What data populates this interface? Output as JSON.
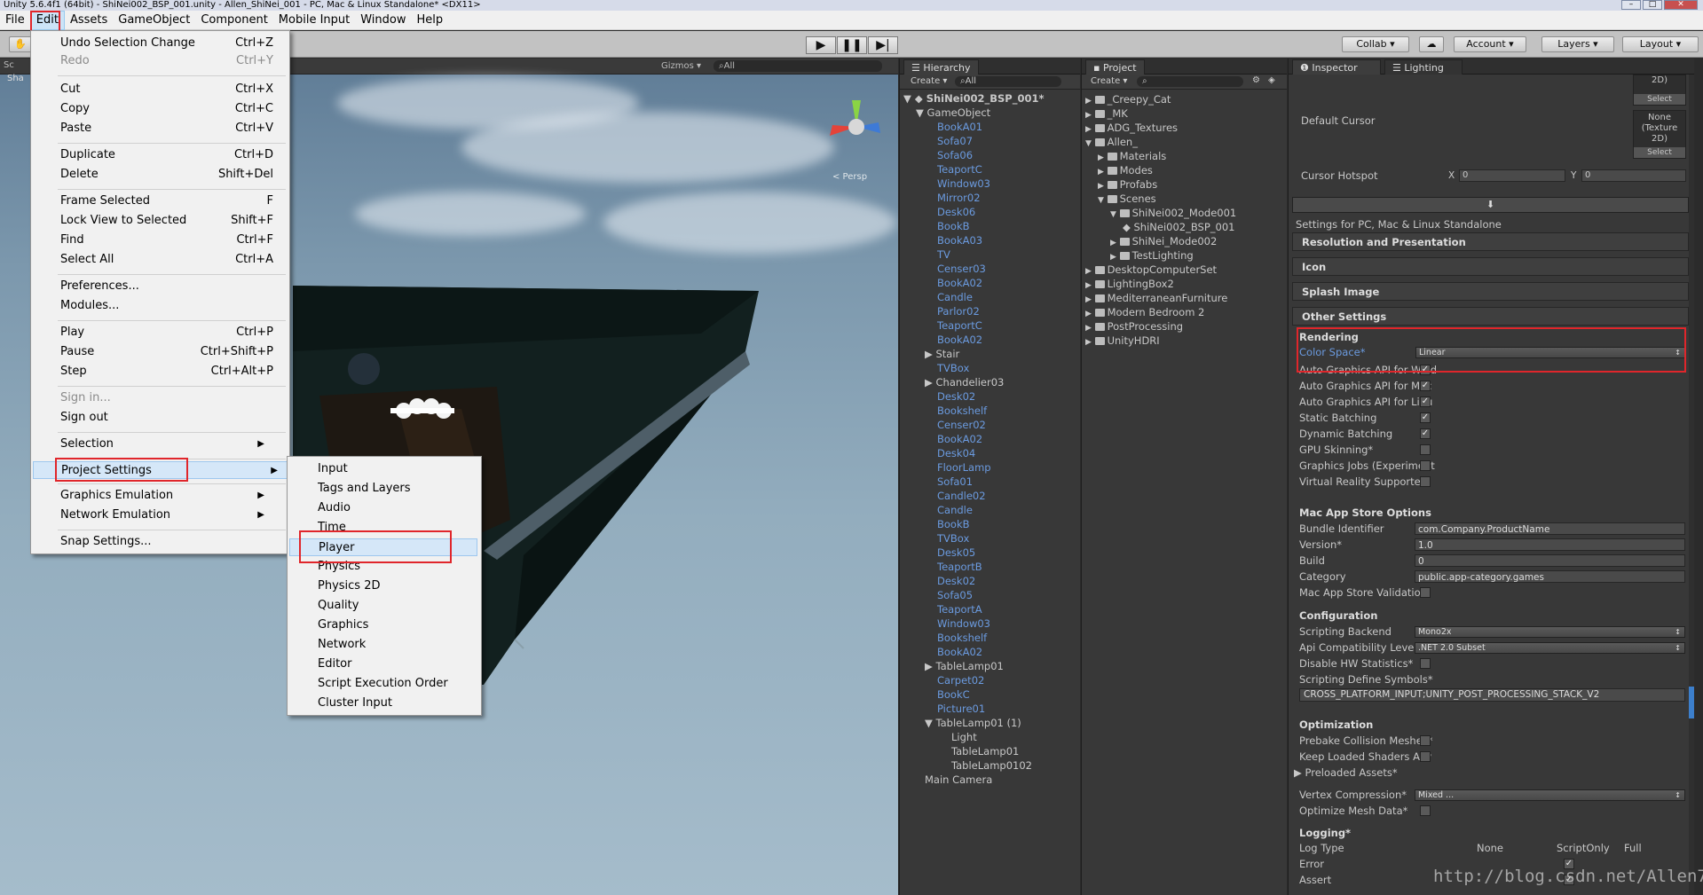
{
  "window": {
    "title": "Unity 5.6.4f1 (64bit) - ShiNei002_BSP_001.unity - Allen_ShiNei_001 - PC, Mac & Linux Standalone* <DX11>"
  },
  "menubar": [
    "File",
    "Edit",
    "Assets",
    "GameObject",
    "Component",
    "Mobile Input",
    "Window",
    "Help"
  ],
  "toolbar": {
    "collab": "Collab ▾",
    "account": "Account",
    "layers": "Layers",
    "layout": "Layout"
  },
  "scene": {
    "gizmos": "Gizmos ▾",
    "search": "All",
    "persp": "< Persp",
    "tab1": "Sc",
    "tab2": "Sha"
  },
  "edit_menu": [
    {
      "label": "Undo Selection Change",
      "shortcut": "Ctrl+Z",
      "disabled": false
    },
    {
      "label": "Redo",
      "shortcut": "Ctrl+Y",
      "disabled": true
    },
    {
      "label": "Cut",
      "shortcut": "Ctrl+X"
    },
    {
      "label": "Copy",
      "shortcut": "Ctrl+C"
    },
    {
      "label": "Paste",
      "shortcut": "Ctrl+V"
    },
    {
      "label": "Duplicate",
      "shortcut": "Ctrl+D"
    },
    {
      "label": "Delete",
      "shortcut": "Shift+Del"
    },
    {
      "label": "Frame Selected",
      "shortcut": "F"
    },
    {
      "label": "Lock View to Selected",
      "shortcut": "Shift+F"
    },
    {
      "label": "Find",
      "shortcut": "Ctrl+F"
    },
    {
      "label": "Select All",
      "shortcut": "Ctrl+A"
    },
    {
      "label": "Preferences...",
      "shortcut": ""
    },
    {
      "label": "Modules...",
      "shortcut": ""
    },
    {
      "label": "Play",
      "shortcut": "Ctrl+P"
    },
    {
      "label": "Pause",
      "shortcut": "Ctrl+Shift+P"
    },
    {
      "label": "Step",
      "shortcut": "Ctrl+Alt+P"
    },
    {
      "label": "Sign in...",
      "shortcut": "",
      "disabled": true
    },
    {
      "label": "Sign out",
      "shortcut": ""
    },
    {
      "label": "Selection",
      "shortcut": ""
    },
    {
      "label": "Project Settings",
      "shortcut": ""
    },
    {
      "label": "Graphics Emulation",
      "shortcut": ""
    },
    {
      "label": "Network Emulation",
      "shortcut": ""
    },
    {
      "label": "Snap Settings...",
      "shortcut": ""
    }
  ],
  "project_settings_submenu": [
    "Input",
    "Tags and Layers",
    "Audio",
    "Time",
    "Player",
    "Physics",
    "Physics 2D",
    "Quality",
    "Graphics",
    "Network",
    "Editor",
    "Script Execution Order",
    "Cluster Input"
  ],
  "hierarchy": {
    "tab": "Hierarchy",
    "create": "Create ▾",
    "search": "All",
    "scene": "ShiNei002_BSP_001*",
    "root": "GameObject",
    "items": [
      "BookA01",
      "Sofa07",
      "Sofa06",
      "TeaportC",
      "Window03",
      "Mirror02",
      "Desk06",
      "BookB",
      "BookA03",
      "TV",
      "Censer03",
      "BookA02",
      "Candle",
      "Parlor02",
      "TeaportC",
      "BookA02",
      "Stair",
      "TVBox",
      "Chandelier03",
      "Desk02",
      "Bookshelf",
      "Censer02",
      "BookA02",
      "Desk04",
      "FloorLamp",
      "Sofa01",
      "Candle02",
      "Candle",
      "BookB",
      "TVBox",
      "Desk05",
      "TeaportB",
      "Desk02",
      "Sofa05",
      "TeaportA",
      "Window03",
      "Bookshelf",
      "BookA02",
      "TableLamp01",
      "Carpet02",
      "BookC",
      "Picture01",
      "TableLamp01 (1)"
    ],
    "lamp_children": [
      "Light",
      "TableLamp01",
      "TableLamp0102"
    ],
    "main_camera": "Main Camera"
  },
  "project": {
    "tab": "Project",
    "create": "Create ▾",
    "tree": [
      {
        "label": "_Creepy_Cat",
        "depth": 0
      },
      {
        "label": "_MK",
        "depth": 0
      },
      {
        "label": "ADG_Textures",
        "depth": 0
      },
      {
        "label": "Allen_",
        "depth": 0
      },
      {
        "label": "Materials",
        "depth": 1
      },
      {
        "label": "Modes",
        "depth": 1
      },
      {
        "label": "Profabs",
        "depth": 1
      },
      {
        "label": "Scenes",
        "depth": 1
      },
      {
        "label": "ShiNei002_Mode001",
        "depth": 2
      },
      {
        "label": "ShiNei002_BSP_001",
        "depth": 3
      },
      {
        "label": "ShiNei_Mode002",
        "depth": 2
      },
      {
        "label": "TestLighting",
        "depth": 2
      },
      {
        "label": "DesktopComputerSet",
        "depth": 0
      },
      {
        "label": "LightingBox2",
        "depth": 0
      },
      {
        "label": "MediterraneanFurniture",
        "depth": 0
      },
      {
        "label": "Modern Bedroom 2",
        "depth": 0
      },
      {
        "label": "PostProcessing",
        "depth": 0
      },
      {
        "label": "UnityHDRI",
        "depth": 0
      }
    ]
  },
  "inspector": {
    "tab": "Inspector",
    "tab2": "Lighting",
    "tex_top": "2D)",
    "select": "Select",
    "default_cursor": "Default Cursor",
    "none_tex": "None (Texture 2D)",
    "cursor_hotspot": "Cursor Hotspot",
    "hotspot_x_label": "X",
    "hotspot_x": "0",
    "hotspot_y_label": "Y",
    "hotspot_y": "0",
    "platform_label": "Settings for PC, Mac & Linux Standalone",
    "sections": [
      "Resolution and Presentation",
      "Icon",
      "Splash Image",
      "Other Settings"
    ],
    "rendering": "Rendering",
    "color_space_label": "Color Space*",
    "color_space": "Linear",
    "checks": [
      {
        "label": "Auto Graphics API for Wind",
        "on": true
      },
      {
        "label": "Auto Graphics API for Mac",
        "on": true
      },
      {
        "label": "Auto Graphics API for Linu",
        "on": true
      },
      {
        "label": "Static Batching",
        "on": true
      },
      {
        "label": "Dynamic Batching",
        "on": true
      },
      {
        "label": "GPU Skinning*",
        "on": false
      },
      {
        "label": "Graphics Jobs (Experiment",
        "on": false
      },
      {
        "label": "Virtual Reality Supported",
        "on": false
      }
    ],
    "mac_store": "Mac App Store Options",
    "bundle_id_label": "Bundle Identifier",
    "bundle_id": "com.Company.ProductName",
    "version_label": "Version*",
    "version": "1.0",
    "build_label": "Build",
    "build": "0",
    "category_label": "Category",
    "category": "public.app-category.games",
    "mas_validation": "Mac App Store Validation",
    "configuration": "Configuration",
    "scripting_backend_label": "Scripting Backend",
    "scripting_backend": "Mono2x",
    "api_label": "Api Compatibility Level*",
    "api": ".NET 2.0 Subset",
    "disable_hw": "Disable HW Statistics*",
    "define_label": "Scripting Define Symbols*",
    "define": "CROSS_PLATFORM_INPUT;UNITY_POST_PROCESSING_STACK_V2",
    "optimization": "Optimization",
    "prebake": "Prebake Collision Meshes*",
    "keep_shaders": "Keep Loaded Shaders Aliv",
    "preloaded": "Preloaded Assets*",
    "vertex_label": "Vertex Compression*",
    "vertex": "Mixed ...",
    "optimize_mesh": "Optimize Mesh Data*",
    "logging": "Logging*",
    "log_type": "Log Type",
    "log_cols": [
      "None",
      "ScriptOnly",
      "Full"
    ],
    "error": "Error",
    "assert": "Assert"
  },
  "watermark": "http://blog.csdn.net/Allen7474",
  "colors": {
    "highlight": "#e0262b",
    "link_blue": "#6b9be0"
  }
}
